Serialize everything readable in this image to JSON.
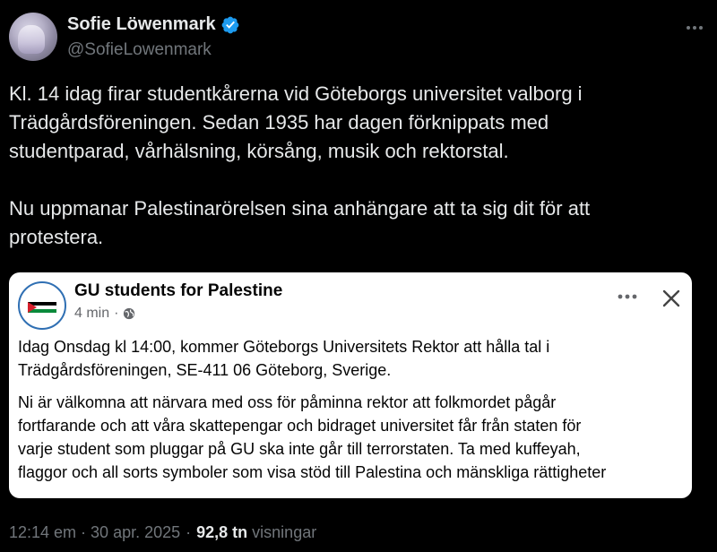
{
  "tweet": {
    "author": {
      "display_name": "Sofie Löwenmark",
      "handle": "@SofieLowenmark",
      "verified": true
    },
    "text": "Kl. 14 idag firar studentkårerna vid Göteborgs universitet valborg i\nTrädgårdsföreningen. Sedan 1935 har dagen förknippats med\nstudentparad, vårhälsning, körsång, musik och rektorstal.\n\nNu uppmanar Palestinarörelsen sina anhängare att ta sig dit för att\nprotestera.",
    "embedded_post": {
      "page_name": "GU students for Palestine",
      "time": "4 min",
      "avatar_text_top": "GU STUDENTS",
      "avatar_text_mid": "FOR",
      "avatar_text_bottom": "PALESTINE",
      "paragraphs": [
        "Idag Onsdag kl 14:00, kommer Göteborgs Universitets Rektor att hålla tal i\nTrädgårdsföreningen, SE-411 06 Göteborg, Sverige.",
        "Ni är välkomna att närvara med oss för påminna rektor att folkmordet pågår\nfortfarande och att våra skattepengar och bidraget universitet får från staten för\nvarje student som pluggar på GU ska inte går till terrorstaten. Ta med kuffeyah,\nflaggor och all sorts symboler som visa stöd till Palestina och mänskliga rättigheter"
      ]
    },
    "timestamp": "12:14 em · 30 apr. 2025",
    "separator": "·",
    "views_count": "92,8 tn",
    "views_label": "visningar"
  },
  "icons": {
    "verified": "verified-badge-icon",
    "more": "more-horizontal-icon",
    "globe": "globe-icon",
    "close": "close-icon"
  },
  "colors": {
    "background": "#000000",
    "verified": "#1d9bf0",
    "muted": "#71767b"
  }
}
